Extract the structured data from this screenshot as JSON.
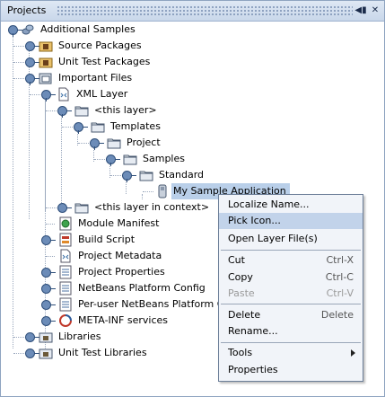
{
  "window": {
    "title": "Projects"
  },
  "colors": {
    "selection": "#b9cfe9",
    "menu_highlight": "#c2d3ea",
    "titlebar": "#c9d7ea"
  },
  "tree": [
    {
      "label": "Additional Samples",
      "icon": "beans-icon",
      "expanded": true
    },
    {
      "label": "Source Packages",
      "icon": "package-folder-icon",
      "expanded": false
    },
    {
      "label": "Unit Test Packages",
      "icon": "package-folder-icon",
      "expanded": false
    },
    {
      "label": "Important Files",
      "icon": "important-files-icon",
      "expanded": true
    },
    {
      "label": "XML Layer",
      "icon": "xml-file-icon",
      "expanded": true
    },
    {
      "label": "<this layer>",
      "icon": "folder-icon",
      "expanded": true
    },
    {
      "label": "Templates",
      "icon": "folder-icon",
      "expanded": true
    },
    {
      "label": "Project",
      "icon": "folder-icon",
      "expanded": true
    },
    {
      "label": "Samples",
      "icon": "folder-icon",
      "expanded": true
    },
    {
      "label": "Standard",
      "icon": "folder-icon",
      "expanded": true
    },
    {
      "label": "My Sample Application",
      "icon": "file-icon",
      "selected": true
    },
    {
      "label": "<this layer in context>",
      "icon": "folder-icon",
      "expanded": false
    },
    {
      "label": "Module Manifest",
      "icon": "manifest-icon"
    },
    {
      "label": "Build Script",
      "icon": "build-script-icon",
      "expanded": false
    },
    {
      "label": "Project Metadata",
      "icon": "metadata-icon"
    },
    {
      "label": "Project Properties",
      "icon": "properties-icon",
      "expanded": false
    },
    {
      "label": "NetBeans Platform Config",
      "icon": "properties-icon",
      "expanded": false
    },
    {
      "label": "Per-user NetBeans Platform C",
      "icon": "properties-icon",
      "expanded": false
    },
    {
      "label": "META-INF services",
      "icon": "services-icon",
      "expanded": false
    },
    {
      "label": "Libraries",
      "icon": "library-folder-icon",
      "expanded": false
    },
    {
      "label": "Unit Test Libraries",
      "icon": "library-folder-icon",
      "expanded": false
    }
  ],
  "context_menu": {
    "items": [
      {
        "label": "Localize Name..."
      },
      {
        "label": "Pick Icon...",
        "highlighted": true
      },
      {
        "label": "Open Layer File(s)"
      },
      {
        "label": "Cut",
        "shortcut": "Ctrl-X"
      },
      {
        "label": "Copy",
        "shortcut": "Ctrl-C"
      },
      {
        "label": "Paste",
        "shortcut": "Ctrl-V",
        "disabled": true
      },
      {
        "label": "Delete",
        "shortcut": "Delete"
      },
      {
        "label": "Rename..."
      },
      {
        "label": "Tools",
        "submenu": true
      },
      {
        "label": "Properties"
      }
    ]
  }
}
